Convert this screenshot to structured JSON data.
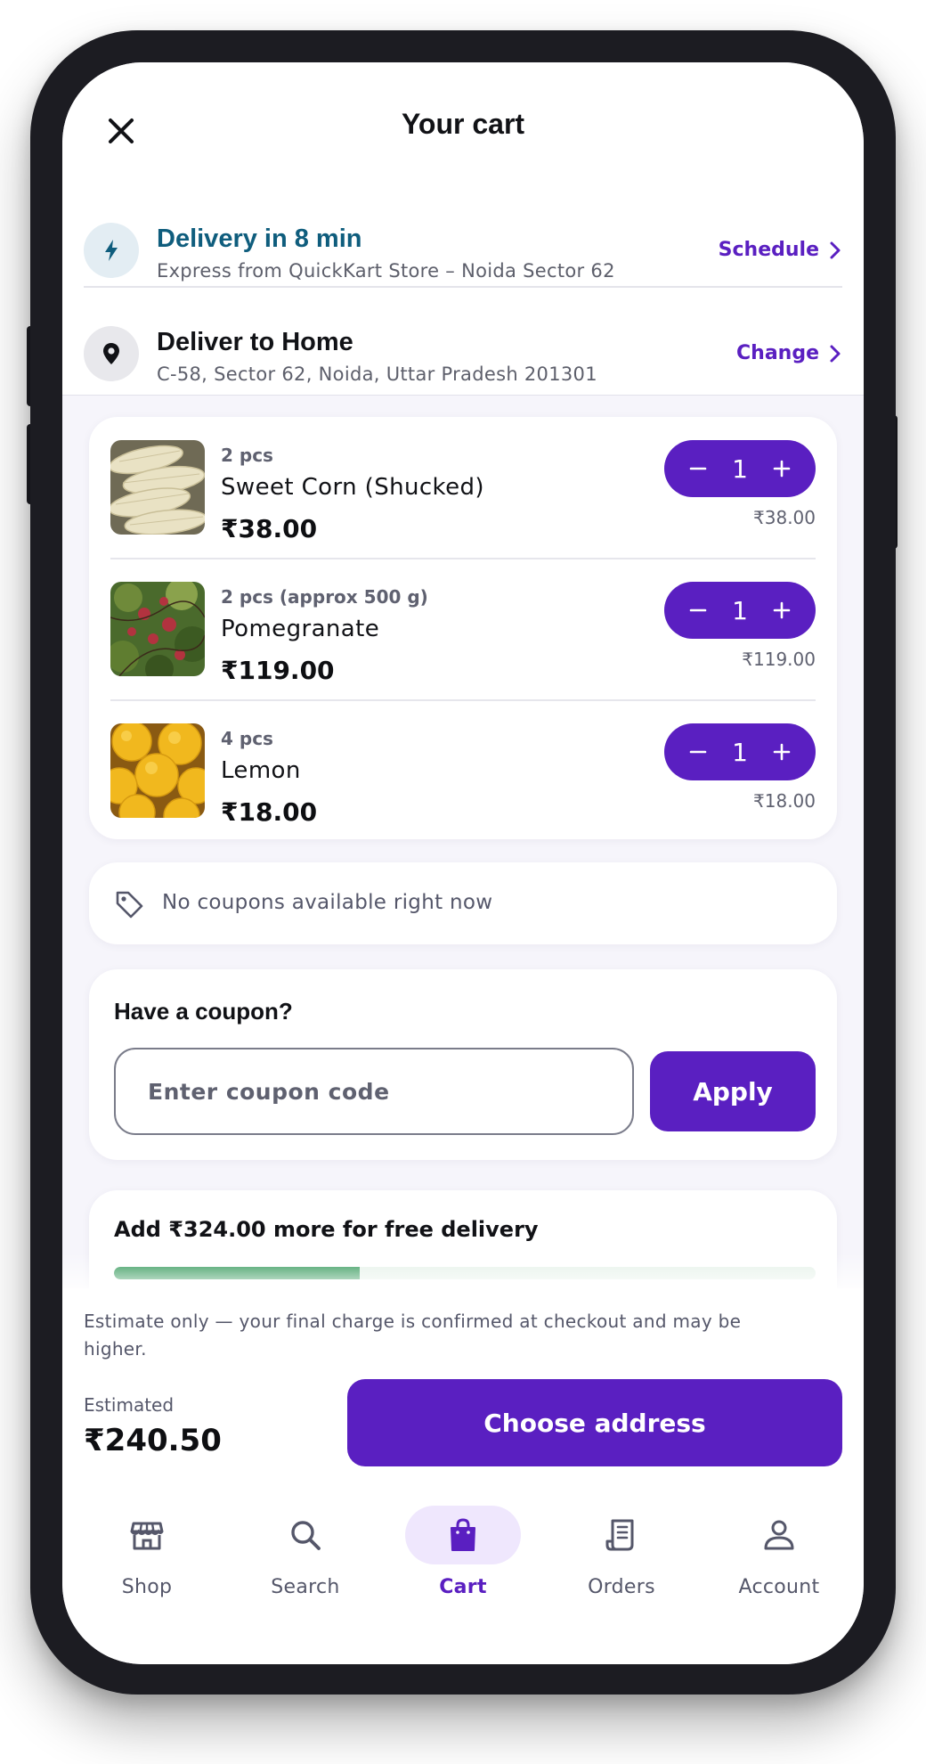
{
  "header": {
    "title": "Your cart"
  },
  "delivery": {
    "title": "Delivery in 8 min",
    "subtitle": "Express from QuickKart Store – Noida Sector 62",
    "action": "Schedule"
  },
  "address": {
    "title": "Deliver to Home",
    "subtitle": "C-58, Sector 62, Noida, Uttar Pradesh 201301",
    "action": "Change"
  },
  "items": [
    {
      "qty_note": "2 pcs",
      "name": "Sweet Corn (Shucked)",
      "price": "₹38.00",
      "quantity": "1",
      "line_total": "₹38.00",
      "image_icon": "sweet-corn-image"
    },
    {
      "qty_note": "2 pcs (approx 500 g)",
      "name": "Pomegranate",
      "price": "₹119.00",
      "quantity": "1",
      "line_total": "₹119.00",
      "image_icon": "pomegranate-image"
    },
    {
      "qty_note": "4 pcs",
      "name": "Lemon",
      "price": "₹18.00",
      "quantity": "1",
      "line_total": "₹18.00",
      "image_icon": "lemon-image"
    }
  ],
  "coupons": {
    "none_text": "No coupons available right now",
    "title": "Have a coupon?",
    "placeholder": "Enter coupon code",
    "apply_label": "Apply"
  },
  "free_delivery": {
    "text": "Add ₹324.00 more for free delivery",
    "progress_percent": 35
  },
  "checkout": {
    "note": "Estimate only — your final charge is confirmed at checkout and may be higher.",
    "estimated_label": "Estimated",
    "estimated_total": "₹240.50",
    "button_label": "Choose address"
  },
  "nav": {
    "items": [
      {
        "label": "Shop",
        "icon": "store-icon",
        "active": false
      },
      {
        "label": "Search",
        "icon": "search-icon",
        "active": false
      },
      {
        "label": "Cart",
        "icon": "shopping-bag-icon",
        "active": true
      },
      {
        "label": "Orders",
        "icon": "receipt-icon",
        "active": false
      },
      {
        "label": "Account",
        "icon": "person-icon",
        "active": false
      }
    ]
  },
  "colors": {
    "accent": "#5a1fc1",
    "delivery_teal": "#0f5d7d",
    "progress_green": "#1a8c45"
  }
}
